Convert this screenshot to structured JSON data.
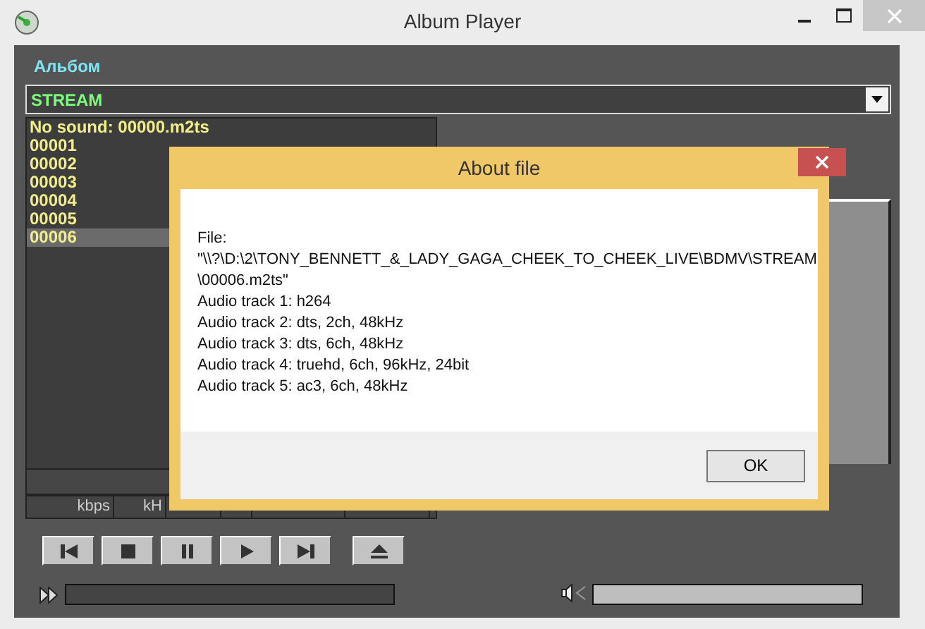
{
  "window": {
    "title": "Album Player"
  },
  "album_label": "Альбом",
  "album_select": {
    "value": "STREAM"
  },
  "files": [
    {
      "label": "No sound: 00000.m2ts",
      "selected": false
    },
    {
      "label": "00001",
      "selected": false
    },
    {
      "label": "00002",
      "selected": false
    },
    {
      "label": "00003",
      "selected": false
    },
    {
      "label": "00004",
      "selected": false
    },
    {
      "label": "00005",
      "selected": false
    },
    {
      "label": "00006",
      "selected": true
    }
  ],
  "info_columns": [
    "kbps",
    "kH"
  ],
  "transport": [
    {
      "kind": "previous"
    },
    {
      "kind": "stop"
    },
    {
      "kind": "pause"
    },
    {
      "kind": "play"
    },
    {
      "kind": "next"
    },
    {
      "kind": "eject"
    }
  ],
  "seek": {
    "level": 0
  },
  "volume": {
    "level": 1
  },
  "dialog": {
    "title": "About file",
    "lines": [
      "File:",
      "\"\\\\?\\D:\\2\\TONY_BENNETT_&_LADY_GAGA_CHEEK_TO_CHEEK_LIVE\\BDMV\\STREAM\\00006.m2ts\"",
      "Audio track 1: h264",
      "Audio track 2: dts, 2ch, 48kHz",
      "Audio track 3: dts, 6ch, 48kHz",
      "Audio track 4: truehd, 6ch, 96kHz, 24bit",
      "Audio track 5: ac3, 6ch, 48kHz"
    ],
    "button": "OK"
  }
}
